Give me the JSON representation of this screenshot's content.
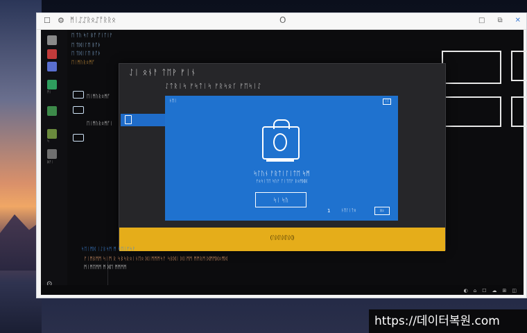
{
  "window": {
    "title": "ᛗᛁᛢᛢᚱᛟᛢᚩᚱᚱᛟ",
    "center_icon": "O",
    "controls": [
      "□",
      "⧉",
      "✕"
    ]
  },
  "rail": {
    "labels": [
      "ᛗᛁ",
      "ᛋ",
      "ᛞᚩᛁ"
    ],
    "bottom_glyph": "⊙"
  },
  "panel": {
    "lines": [
      "ᛖ ᛏᚢ ᛋᛚ ᛒᚩ ᚩᛁᛏᛁᚨ",
      "ᛖ ᛏᛞᛁᛚᛖ ᛒᚩᚦ",
      "ᛖᛁᛗᚢᚱᛟᛗᚩ",
      "ᛖᛁᛗᚢᚱᛟᛗᚩᛁ"
    ]
  },
  "dialog": {
    "title": "ᛇᛁ   ᛟᚾᚨ ᛏᛖᚹ ᚠᛁᚾ",
    "subtitle": "ᛇᛏᚱᛁᛋ ᚠᛋᛏᛁᛋ ᚠᚱᛋᛟᚴ ᚠᛖᛋᛁᛇ"
  },
  "modal": {
    "top_left": "ᚾᛖᛁ",
    "top_right": "ᛁᚷ",
    "heading": "ᛋᛚᚢᚾ ᚨᚱᛏᛁᛚᛁᛏᛖ ᛋᛗ",
    "text": "ᚠᛟᛋᛁᛏᛖ ᛋᚢᚠ ᚩᛁᛏᛖᚠ ᛒᛟᛗᛞᛞ",
    "button_label": "ᛋᛁ ᛋᚢ",
    "number": "1",
    "link": "ᚾᛖᛚᛁᛏᛟ",
    "check": "ᛞᛟ"
  },
  "banner": {
    "label": "(ᚢᛞᚢᛞᚢᛞ)"
  },
  "bottom_lines": [
    "ᛋᛖᛁᛗᛞ ᛁᛇᛒᛋᛗ ᛗ ᛋᛖᛁᚠᛋᚹ",
    "ᚠᛁᛗᛒᛗᛗ ᛋᛁᛗ ᚱ ᛋᛒᛋᚱᛟᛁᚾᛖᛟ ᛞᛁᛗᛗᛗᛋᚨ ᛋᛒᛞᛁ ᛞᛁᛗᛗ ᛗᛗᚱᛗ ᛞᛗᛗᛞᛟᛗᛞ",
    "ᛗᛁᛗᛖᛗᛗ ᛗ ᛞᛖ ᛗᛗᛗᛗ"
  ],
  "tray": [
    "◐",
    "⌂",
    "☐",
    "☁",
    "⊞",
    "◫"
  ],
  "watermark": "https://데이터복원.com",
  "colors": {
    "modal_blue": "#1f72cf",
    "banner_yellow": "#e5ad1a",
    "dialog_dark": "#262629",
    "selection_blue": "#1f6cc9"
  }
}
